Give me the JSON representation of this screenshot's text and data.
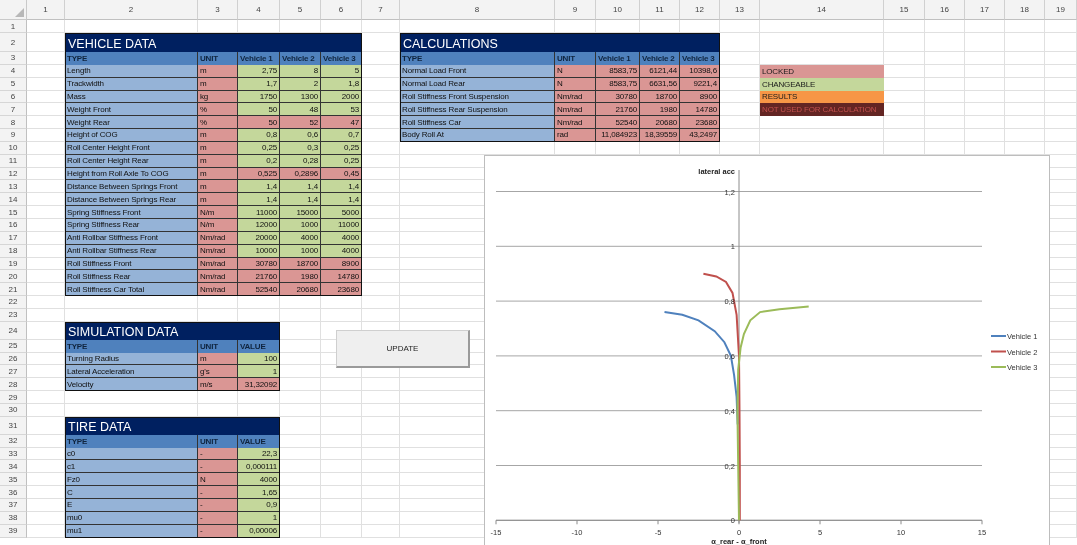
{
  "sheet": {
    "columns": [
      "1",
      "2",
      "3",
      "4",
      "5",
      "6",
      "7",
      "8",
      "9",
      "10",
      "11",
      "12",
      "13",
      "14",
      "15",
      "16",
      "17",
      "18",
      "19"
    ],
    "rows": [
      "1",
      "2",
      "3",
      "4",
      "5",
      "6",
      "7",
      "8",
      "9",
      "10",
      "11",
      "12",
      "13",
      "14",
      "15",
      "16",
      "17",
      "18",
      "19",
      "20",
      "21",
      "22",
      "23",
      "24",
      "25",
      "26",
      "27",
      "28",
      "29",
      "30",
      "31",
      "32",
      "33",
      "34",
      "35",
      "36",
      "37",
      "38",
      "39"
    ]
  },
  "vehicle_data": {
    "title": "VEHICLE DATA",
    "header": [
      "TYPE",
      "UNIT",
      "Vehicle 1",
      "Vehicle 2",
      "Vehicle 3"
    ],
    "rows": [
      {
        "type": "Length",
        "unit": "m",
        "values": [
          "2,75",
          "8",
          "5"
        ],
        "locked": false
      },
      {
        "type": "Trackwidth",
        "unit": "m",
        "values": [
          "1,7",
          "2",
          "1,8"
        ],
        "locked": false
      },
      {
        "type": "Mass",
        "unit": "kg",
        "values": [
          "1750",
          "1300",
          "2000"
        ],
        "locked": false
      },
      {
        "type": "Weight Front",
        "unit": "%",
        "values": [
          "50",
          "48",
          "53"
        ],
        "locked": false
      },
      {
        "type": "Weight Rear",
        "unit": "%",
        "values": [
          "50",
          "52",
          "47"
        ],
        "locked": true
      },
      {
        "type": "Height of COG",
        "unit": "m",
        "values": [
          "0,8",
          "0,6",
          "0,7"
        ],
        "locked": false
      },
      {
        "type": "Roll Center Height Front",
        "unit": "m",
        "values": [
          "0,25",
          "0,3",
          "0,25"
        ],
        "locked": false
      },
      {
        "type": "Roll Center Height Rear",
        "unit": "m",
        "values": [
          "0,2",
          "0,28",
          "0,25"
        ],
        "locked": false
      },
      {
        "type": "Height from Roll Axle To COG",
        "unit": "m",
        "values": [
          "0,525",
          "0,2896",
          "0,45"
        ],
        "locked": true
      },
      {
        "type": "Distance Between Springs Front",
        "unit": "m",
        "values": [
          "1,4",
          "1,4",
          "1,4"
        ],
        "locked": false
      },
      {
        "type": "Distance Between Springs Rear",
        "unit": "m",
        "values": [
          "1,4",
          "1,4",
          "1,4"
        ],
        "locked": false
      },
      {
        "type": "Spring Stiffness Front",
        "unit": "N/m",
        "values": [
          "11000",
          "15000",
          "5000"
        ],
        "locked": false
      },
      {
        "type": "Spring Stiffness Rear",
        "unit": "N/m",
        "values": [
          "12000",
          "1000",
          "11000"
        ],
        "locked": false
      },
      {
        "type": "Anti Rollbar Stiffness Front",
        "unit": "Nm/rad",
        "values": [
          "20000",
          "4000",
          "4000"
        ],
        "locked": false
      },
      {
        "type": "Anti Rollbar Stiffness Rear",
        "unit": "Nm/rad",
        "values": [
          "10000",
          "1000",
          "4000"
        ],
        "locked": false
      },
      {
        "type": "Roll Stiffness Front",
        "unit": "Nm/rad",
        "values": [
          "30780",
          "18700",
          "8900"
        ],
        "locked": true
      },
      {
        "type": "Roll Stiffness Rear",
        "unit": "Nm/rad",
        "values": [
          "21760",
          "1980",
          "14780"
        ],
        "locked": true
      },
      {
        "type": "Roll Stiffness Car Total",
        "unit": "Nm/rad",
        "values": [
          "52540",
          "20680",
          "23680"
        ],
        "locked": true
      }
    ]
  },
  "calculations": {
    "title": "CALCULATIONS",
    "header": [
      "TYPE",
      "UNIT",
      "Vehicle 1",
      "Vehicle 2",
      "Vehicle 3"
    ],
    "rows": [
      {
        "type": "Normal Load Front",
        "unit": "N",
        "values": [
          "8583,75",
          "6121,44",
          "10398,6"
        ],
        "locked": true
      },
      {
        "type": "Normal Load Rear",
        "unit": "N",
        "values": [
          "8583,75",
          "6631,56",
          "9221,4"
        ],
        "locked": true
      },
      {
        "type": "Roll Stiffness Front Suspension",
        "unit": "Nm/rad",
        "values": [
          "30780",
          "18700",
          "8900"
        ],
        "locked": true
      },
      {
        "type": "Roll Stiffness Rear Suspension",
        "unit": "Nm/rad",
        "values": [
          "21760",
          "1980",
          "14780"
        ],
        "locked": true
      },
      {
        "type": "Roll Stiffness Car",
        "unit": "Nm/rad",
        "values": [
          "52540",
          "20680",
          "23680"
        ],
        "locked": true
      },
      {
        "type": "Body Roll At",
        "unit": "rad",
        "values": [
          "11,084923",
          "18,39559",
          "43,2497"
        ],
        "locked": true
      }
    ]
  },
  "legend": [
    {
      "label": "LOCKED",
      "kind": "locked"
    },
    {
      "label": "CHANGEABLE",
      "kind": "changeable"
    },
    {
      "label": "RESULTS",
      "kind": "results"
    },
    {
      "label": "NOT USED FOR CALCULATION",
      "kind": "unused"
    }
  ],
  "simulation_data": {
    "title": "SIMULATION DATA",
    "header": [
      "TYPE",
      "UNIT",
      "VALUE"
    ],
    "rows": [
      {
        "type": "Turning Radius",
        "unit": "m",
        "values": [
          "100"
        ],
        "locked": false
      },
      {
        "type": "Lateral Acceleration",
        "unit": "g's",
        "values": [
          "1"
        ],
        "locked": false
      },
      {
        "type": "Velocity",
        "unit": "m/s",
        "values": [
          "31,32092"
        ],
        "locked": true
      }
    ]
  },
  "update_button": {
    "label": "UPDATE"
  },
  "tire_data": {
    "title": "TIRE DATA",
    "header": [
      "TYPE",
      "UNIT",
      "VALUE"
    ],
    "rows": [
      {
        "type": "c0",
        "unit": "-",
        "values": [
          "22,3"
        ],
        "locked": false
      },
      {
        "type": "c1",
        "unit": "-",
        "values": [
          "0,000111"
        ],
        "locked": false
      },
      {
        "type": "Fz0",
        "unit": "N",
        "values": [
          "4000"
        ],
        "locked": false
      },
      {
        "type": "C",
        "unit": "-",
        "values": [
          "1,65"
        ],
        "locked": false
      },
      {
        "type": "E",
        "unit": "-",
        "values": [
          "0,9"
        ],
        "locked": false
      },
      {
        "type": "mu0",
        "unit": "-",
        "values": [
          "1"
        ],
        "locked": false
      },
      {
        "type": "mu1",
        "unit": "-",
        "values": [
          "0,00006"
        ],
        "locked": false
      }
    ]
  },
  "chart": {
    "chart_data": {
      "type": "line",
      "xlabel": "α_rear - α_front",
      "ylabel": "lateral acc",
      "xlim": [
        -15,
        15
      ],
      "ylim": [
        0,
        1.2
      ],
      "grid": true,
      "legend": "right",
      "xticks": [
        -15,
        -10,
        -5,
        0,
        5,
        10,
        15
      ],
      "yticks": [
        {
          "value": 0,
          "label": "0"
        },
        {
          "value": 0.2,
          "label": "0,2"
        },
        {
          "value": 0.4,
          "label": "0,4"
        },
        {
          "value": 0.6,
          "label": "0,6"
        },
        {
          "value": 0.8,
          "label": "0,8"
        },
        {
          "value": 1,
          "label": "1"
        },
        {
          "value": 1.2,
          "label": "1,2"
        }
      ],
      "series": [
        {
          "name": "Vehicle 1",
          "color": "#4f81bd",
          "x": [
            -0.08,
            -0.15,
            -0.3,
            -0.5,
            -0.9,
            -1.5,
            -2.5,
            -3.5,
            -4.6
          ],
          "values": [
            0.35,
            0.45,
            0.53,
            0.6,
            0.65,
            0.69,
            0.73,
            0.75,
            0.76
          ]
        },
        {
          "name": "Vehicle 2",
          "color": "#c0504d",
          "x": [
            0.05,
            0.05,
            0.03,
            0,
            -0.15,
            -0.4,
            -0.8,
            -1.4,
            -2.2
          ],
          "values": [
            0,
            0.2,
            0.4,
            0.6,
            0.75,
            0.83,
            0.87,
            0.89,
            0.9
          ]
        },
        {
          "name": "Vehicle 3",
          "color": "#9bbb59",
          "x": [
            0,
            -0.05,
            -0.1,
            -0.05,
            0.1,
            0.3,
            0.7,
            1.3,
            2.5,
            4.3
          ],
          "values": [
            0,
            0.2,
            0.4,
            0.55,
            0.63,
            0.68,
            0.73,
            0.76,
            0.77,
            0.78
          ]
        }
      ]
    }
  }
}
